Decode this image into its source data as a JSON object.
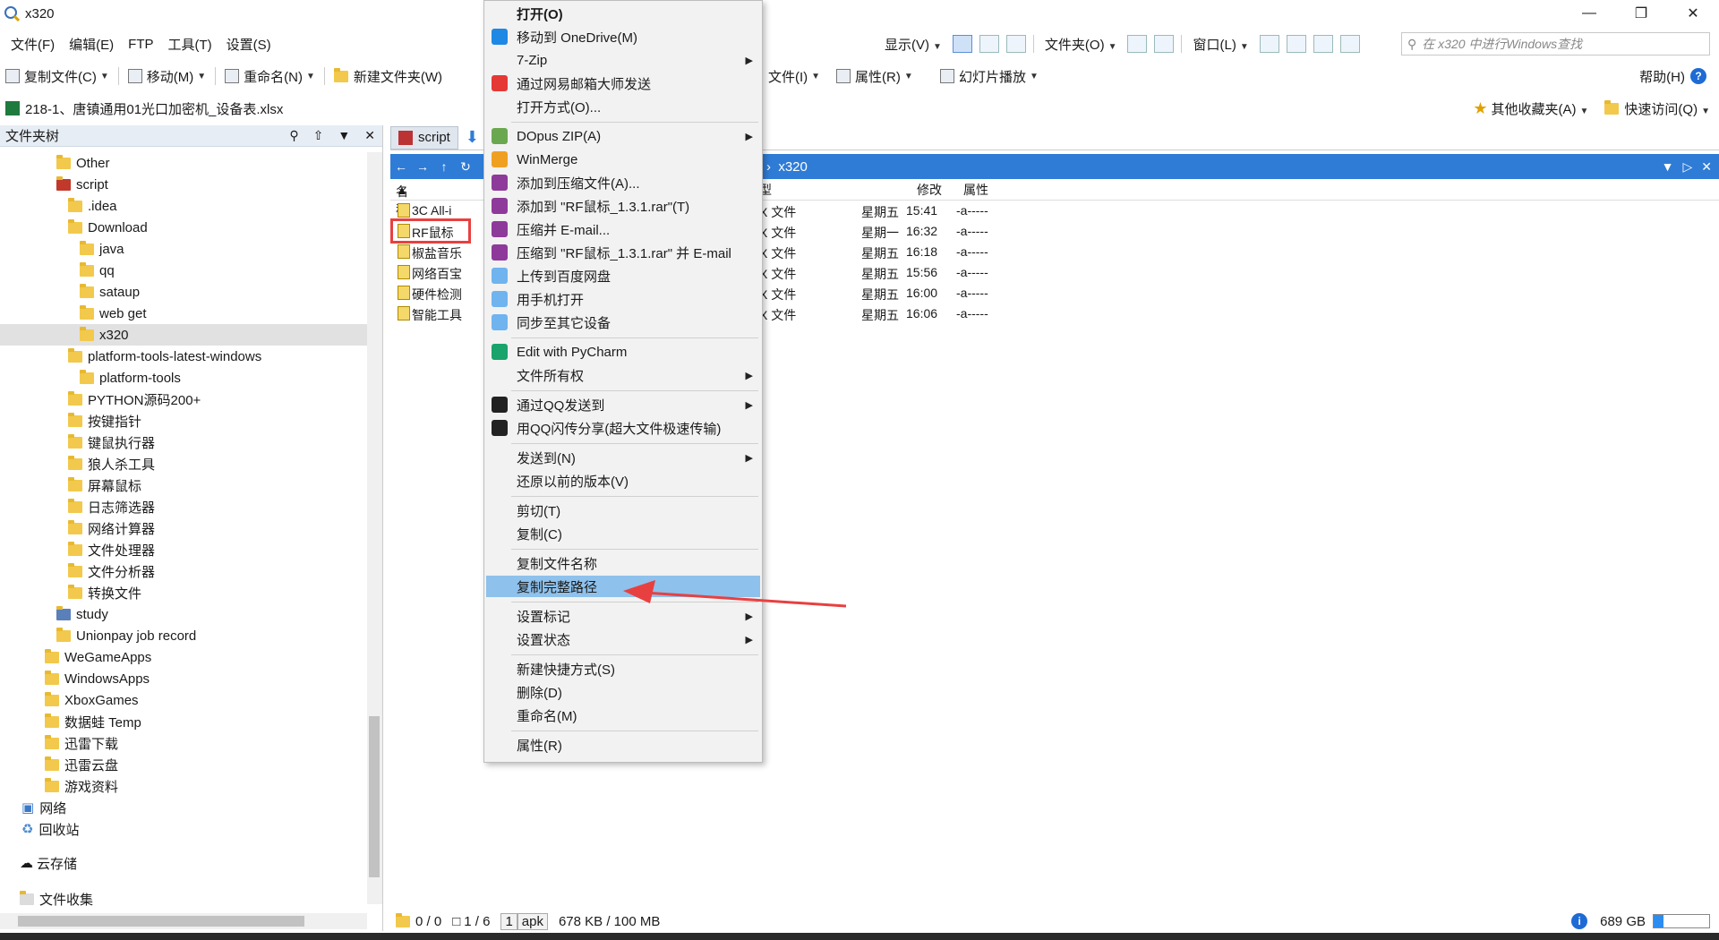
{
  "window": {
    "title": "x320"
  },
  "menubar": {
    "items": [
      "文件(F)",
      "编辑(E)",
      "FTP",
      "工具(T)",
      "设置(S)"
    ],
    "display_label": "显示(V)",
    "folder_label": "文件夹(O)",
    "window_label": "窗口(L)",
    "search_placeholder": "在 x320 中进行Windows查找"
  },
  "toolbar": {
    "copy_file": "复制文件(C)",
    "move": "移动(M)",
    "rename": "重命名(N)",
    "new_folder": "新建文件夹(W)",
    "file_partial": "文件(I)",
    "properties": "属性(R)",
    "slideshow": "幻灯片播放",
    "help": "帮助(H)"
  },
  "pathbar": {
    "file": "218-1、唐镇通用01光口加密机_设备表.xlsx",
    "other_favorites": "其他收藏夹(A)",
    "quick_access": "快速访问(Q)"
  },
  "left_pane": {
    "header": "文件夹树",
    "tree": [
      {
        "label": "Other",
        "level": 5
      },
      {
        "label": "script",
        "level": 5
      },
      {
        "label": ".idea",
        "level": 6
      },
      {
        "label": "Download",
        "level": 6
      },
      {
        "label": "java",
        "level": 7
      },
      {
        "label": "qq",
        "level": 7
      },
      {
        "label": "sataup",
        "level": 7
      },
      {
        "label": "web get",
        "level": 7
      },
      {
        "label": "x320",
        "level": 7,
        "selected": true
      },
      {
        "label": "platform-tools-latest-windows",
        "level": 6
      },
      {
        "label": "platform-tools",
        "level": 7
      },
      {
        "label": "PYTHON源码200+",
        "level": 6
      },
      {
        "label": "按键指针",
        "level": 6
      },
      {
        "label": "键鼠执行器",
        "level": 6
      },
      {
        "label": "狼人杀工具",
        "level": 6
      },
      {
        "label": "屏幕鼠标",
        "level": 6
      },
      {
        "label": "日志筛选器",
        "level": 6
      },
      {
        "label": "网络计算器",
        "level": 6
      },
      {
        "label": "文件处理器",
        "level": 6
      },
      {
        "label": "文件分析器",
        "level": 6
      },
      {
        "label": "转换文件",
        "level": 6
      },
      {
        "label": "study",
        "level": 5
      },
      {
        "label": "Unionpay job record",
        "level": 5
      },
      {
        "label": "WeGameApps",
        "level": 4
      },
      {
        "label": "WindowsApps",
        "level": 4
      },
      {
        "label": "XboxGames",
        "level": 4
      },
      {
        "label": "数据蛙 Temp",
        "level": 4
      },
      {
        "label": "迅雷下载",
        "level": 4
      },
      {
        "label": "迅雷云盘",
        "level": 4
      },
      {
        "label": "游戏资料",
        "level": 4
      },
      {
        "label": "网络",
        "level": 2
      },
      {
        "label": "回收站",
        "level": 2
      }
    ],
    "cloud": "云存储",
    "collection": "文件收集"
  },
  "right_pane": {
    "tab": "script",
    "nav_path": "x320",
    "columns": {
      "name": "名称",
      "type_partial": "型",
      "modified": "修改",
      "attr": "属性"
    },
    "files": [
      {
        "name": "3C All-i",
        "type": "X 文件",
        "day": "星期五",
        "time": "15:41",
        "attr": "-a-----"
      },
      {
        "name": "RF鼠标",
        "type": "X 文件",
        "day": "星期一",
        "time": "16:32",
        "attr": "-a-----"
      },
      {
        "name": "椒盐音乐",
        "type": "X 文件",
        "day": "星期五",
        "time": "16:18",
        "attr": "-a-----"
      },
      {
        "name": "网络百宝",
        "type": "X 文件",
        "day": "星期五",
        "time": "15:56",
        "attr": "-a-----"
      },
      {
        "name": "硬件检测",
        "type": "X 文件",
        "day": "星期五",
        "time": "16:00",
        "attr": "-a-----"
      },
      {
        "name": "智能工具",
        "type": "X 文件",
        "day": "星期五",
        "time": "16:06",
        "attr": "-a-----"
      }
    ]
  },
  "statusbar": {
    "folders": "0 / 0",
    "files": "1 / 6",
    "count": "1",
    "ext": "apk",
    "size": "678 KB / 100 MB",
    "disk": "689 GB",
    "disk_used_fraction": 0.18
  },
  "context_menu": {
    "items": [
      {
        "label": "打开(O)",
        "bold": true
      },
      {
        "label": "移动到 OneDrive(M)",
        "icon": "onedrive-icon"
      },
      {
        "label": "7-Zip",
        "submenu": true
      },
      {
        "label": "通过网易邮箱大师发送",
        "icon": "netease-mail-icon"
      },
      {
        "label": "打开方式(O)..."
      },
      {
        "label": "DOpus ZIP(A)",
        "submenu": true,
        "icon": "dopus-zip-icon"
      },
      {
        "label": "WinMerge",
        "icon": "winmerge-icon"
      },
      {
        "label": "添加到压缩文件(A)...",
        "icon": "winrar-icon"
      },
      {
        "label": "添加到 \"RF鼠标_1.3.1.rar\"(T)",
        "icon": "winrar-icon"
      },
      {
        "label": "压缩并 E-mail...",
        "icon": "winrar-icon"
      },
      {
        "label": "压缩到 \"RF鼠标_1.3.1.rar\" 并 E-mail",
        "icon": "winrar-icon"
      },
      {
        "label": "上传到百度网盘",
        "icon": "baidu-cloud-icon"
      },
      {
        "label": "用手机打开",
        "icon": "baidu-cloud-icon"
      },
      {
        "label": "同步至其它设备",
        "icon": "baidu-cloud-icon"
      },
      {
        "label": "Edit with PyCharm",
        "icon": "pycharm-icon"
      },
      {
        "label": "文件所有权",
        "submenu": true
      },
      {
        "label": "通过QQ发送到",
        "submenu": true,
        "icon": "qq-icon"
      },
      {
        "label": "用QQ闪传分享(超大文件极速传输)",
        "icon": "qq-icon"
      },
      {
        "label": "发送到(N)",
        "submenu": true
      },
      {
        "label": "还原以前的版本(V)"
      },
      {
        "label": "剪切(T)"
      },
      {
        "label": "复制(C)"
      },
      {
        "label": "复制文件名称"
      },
      {
        "label": "复制完整路径",
        "highlighted": true
      },
      {
        "label": "设置标记",
        "submenu": true
      },
      {
        "label": "设置状态",
        "submenu": true
      },
      {
        "label": "新建快捷方式(S)"
      },
      {
        "label": "删除(D)"
      },
      {
        "label": "重命名(M)"
      },
      {
        "label": "属性(R)"
      }
    ]
  },
  "colors": {
    "accent": "#2f7cd6",
    "highlight": "#8ec1ec",
    "annotation": "#e84040"
  }
}
